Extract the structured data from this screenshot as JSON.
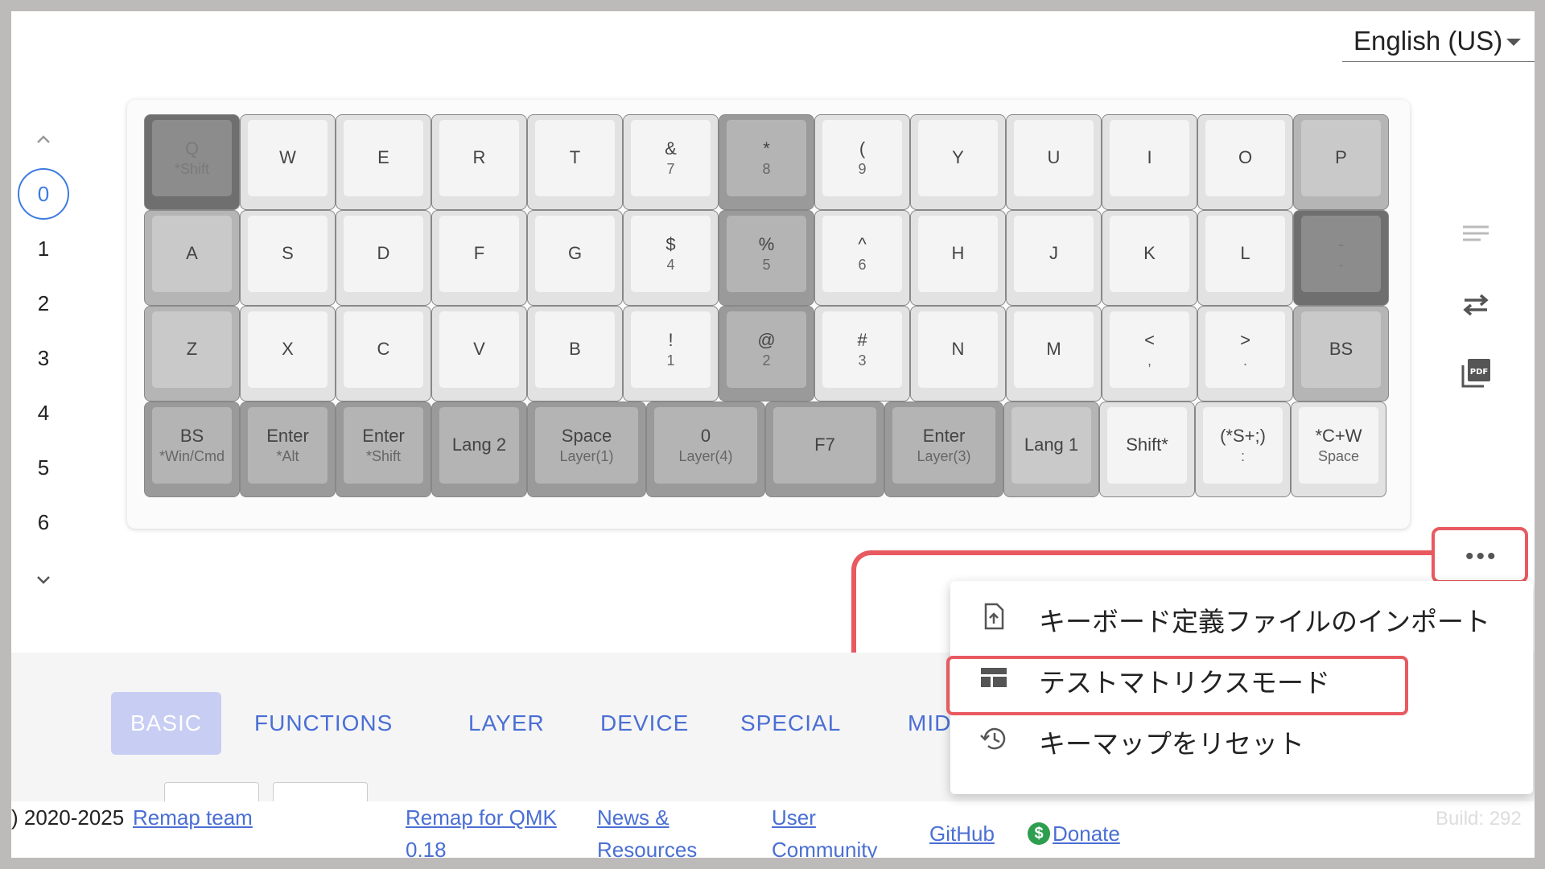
{
  "language_selector": {
    "value": "English (US)"
  },
  "layers": {
    "items": [
      "0",
      "1",
      "2",
      "3",
      "4",
      "5",
      "6"
    ],
    "selected": "0"
  },
  "keyboard": {
    "rows": [
      [
        {
          "top": "Q",
          "sub": "*Shift",
          "tone": "x"
        },
        {
          "top": "W",
          "tone": "l"
        },
        {
          "top": "E",
          "tone": "l"
        },
        {
          "top": "R",
          "tone": "l"
        },
        {
          "top": "T",
          "tone": "l"
        },
        {
          "top": "&",
          "sub": "7",
          "tone": "l"
        },
        {
          "top": "*",
          "sub": "8",
          "tone": "d"
        },
        {
          "top": "(",
          "sub": "9",
          "tone": "l"
        },
        {
          "top": "Y",
          "tone": "l"
        },
        {
          "top": "U",
          "tone": "l"
        },
        {
          "top": "I",
          "tone": "l"
        },
        {
          "top": "O",
          "tone": "l"
        },
        {
          "top": "P",
          "tone": "m"
        }
      ],
      [
        {
          "top": "A",
          "tone": "m"
        },
        {
          "top": "S",
          "tone": "l"
        },
        {
          "top": "D",
          "tone": "l"
        },
        {
          "top": "F",
          "tone": "l"
        },
        {
          "top": "G",
          "tone": "l"
        },
        {
          "top": "$",
          "sub": "4",
          "tone": "l"
        },
        {
          "top": "%",
          "sub": "5",
          "tone": "d"
        },
        {
          "top": "^",
          "sub": "6",
          "tone": "l"
        },
        {
          "top": "H",
          "tone": "l"
        },
        {
          "top": "J",
          "tone": "l"
        },
        {
          "top": "K",
          "tone": "l"
        },
        {
          "top": "L",
          "tone": "l"
        },
        {
          "top": "-",
          "sub": "-",
          "tone": "x"
        }
      ],
      [
        {
          "top": "Z",
          "tone": "m"
        },
        {
          "top": "X",
          "tone": "l"
        },
        {
          "top": "C",
          "tone": "l"
        },
        {
          "top": "V",
          "tone": "l"
        },
        {
          "top": "B",
          "tone": "l"
        },
        {
          "top": "!",
          "sub": "1",
          "tone": "l"
        },
        {
          "top": "@",
          "sub": "2",
          "tone": "d"
        },
        {
          "top": "#",
          "sub": "3",
          "tone": "l"
        },
        {
          "top": "N",
          "tone": "l"
        },
        {
          "top": "M",
          "tone": "l"
        },
        {
          "top": "<",
          "sub": ",",
          "tone": "l"
        },
        {
          "top": ">",
          "sub": ".",
          "tone": "l"
        },
        {
          "top": "BS",
          "tone": "m"
        }
      ],
      [
        {
          "top": "BS",
          "sub": "*Win/Cmd",
          "tone": "d"
        },
        {
          "top": "Enter",
          "sub": "*Alt",
          "tone": "d"
        },
        {
          "top": "Enter",
          "sub": "*Shift",
          "tone": "d"
        },
        {
          "top": "Lang 2",
          "tone": "d"
        },
        {
          "top": "Space",
          "sub": "Layer(1)",
          "tone": "d"
        },
        {
          "top": "0",
          "sub": "Layer(4)",
          "tone": "d"
        },
        {
          "top": "F7",
          "tone": "d"
        },
        {
          "top": "Enter",
          "sub": "Layer(3)",
          "tone": "d"
        },
        {
          "top": "Lang 1",
          "tone": "m"
        },
        {
          "top": "Shift*",
          "tone": "l"
        },
        {
          "top": "(*S+;)",
          "sub": ":",
          "tone": "l"
        },
        {
          "top": "*C+W",
          "sub": "Space",
          "tone": "l"
        }
      ]
    ]
  },
  "side_icons": [
    "list-icon",
    "swap-icon",
    "pdf-icon"
  ],
  "more_button": {
    "label": "•••"
  },
  "context_menu": {
    "items": [
      {
        "label": "キーボード定義ファイルのインポート",
        "icon": "file-upload-icon"
      },
      {
        "label": "テストマトリクスモード",
        "icon": "table-icon"
      },
      {
        "label": "キーマップをリセット",
        "icon": "history-icon"
      }
    ]
  },
  "categories": {
    "tabs": [
      "BASIC",
      "FUNCTIONS",
      "LAYER",
      "DEVICE",
      "SPECIAL",
      "MID"
    ],
    "selected": "BASIC"
  },
  "footer": {
    "copyright": ") 2020-2025",
    "team_link": "Remap team",
    "remap_qmk_1": "Remap for QMK",
    "remap_qmk_2": "0.18",
    "news_1": "News &",
    "news_2": "Resources",
    "user_1": "User",
    "user_2": "Community",
    "github": "GitHub",
    "donate": "Donate",
    "donate_icon": "$",
    "build": "Build: 292"
  },
  "colors": {
    "accent": "#4a6fd4",
    "highlight": "#e85a60",
    "selected_tab_bg": "#c7cdf3"
  }
}
